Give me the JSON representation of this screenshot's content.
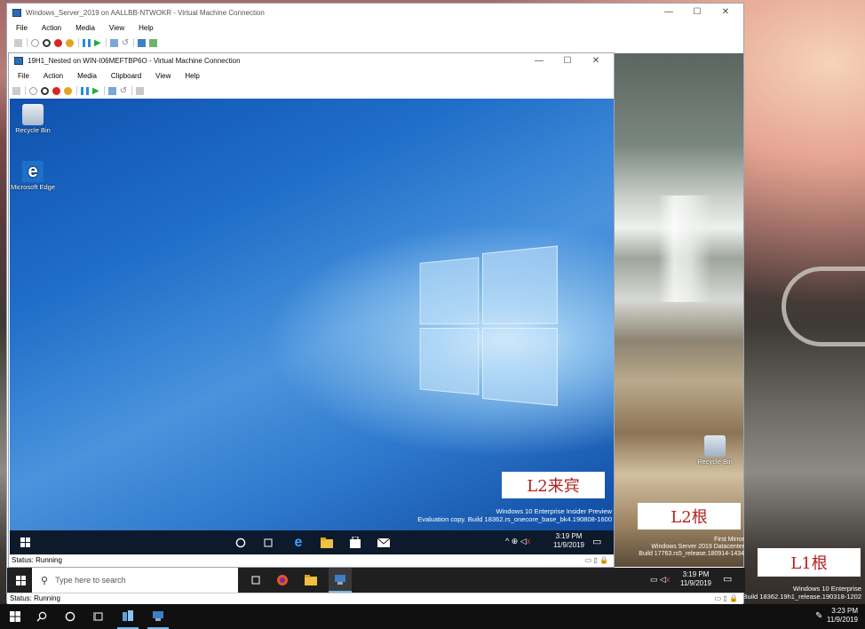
{
  "host": {
    "taskbar_icons": [
      "windows-logo",
      "search-icon",
      "cortana-icon",
      "task-view-icon",
      "file-explorer-icon",
      "hyperv-manager-icon"
    ],
    "clock_time": "3:23 PM",
    "clock_date": "11/9/2019",
    "watermark_line1": "Windows 10 Enterprise",
    "watermark_line2": "Build 18362.19h1_release.190318-1202",
    "label": "L1根"
  },
  "vm1": {
    "title": "Windows_Server_2019 on AALLBB-NTWOKR - Virtual Machine Connection",
    "menu": [
      "File",
      "Action",
      "Media",
      "View",
      "Help"
    ],
    "status": "Status: Running",
    "taskbar_search_placeholder": "Type here to search",
    "clock_time": "3:19 PM",
    "clock_date": "11/9/2019",
    "watermark_line1": "First Mirror",
    "watermark_line2": "Windows Server 2019 Datacenter",
    "watermark_line3": "Build 17763.rs5_release.180914-1434",
    "recycle_bin_label": "Recycle Bin",
    "label": "L2根"
  },
  "vm2": {
    "title": "19H1_Nested on WIN-I06MEFTBP6O - Virtual Machine Connection",
    "menu": [
      "File",
      "Action",
      "Media",
      "Clipboard",
      "View",
      "Help"
    ],
    "status": "Status: Running",
    "desktop_icons": [
      {
        "label": "Recycle Bin"
      },
      {
        "label": "Microsoft Edge"
      }
    ],
    "watermark_line1": "Windows 10 Enterprise Insider Preview",
    "watermark_line2": "Evaluation copy. Build 18362.rs_onecore_base_bk4.190808-1600",
    "clock_time": "3:19 PM",
    "clock_date": "11/9/2019",
    "label": "L2来宾"
  },
  "colors": {
    "accent": "#0078d7",
    "label_red": "#b41e1e"
  }
}
